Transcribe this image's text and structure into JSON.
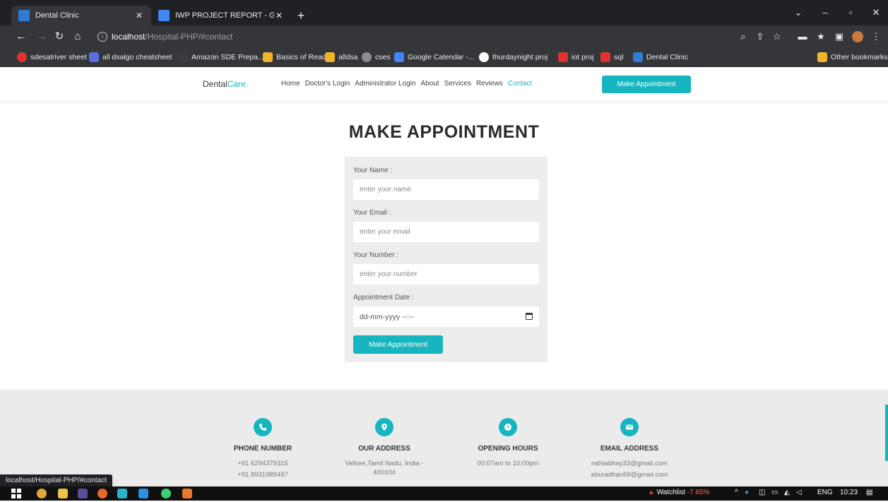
{
  "browser": {
    "tabs": [
      {
        "label": "Dental Clinic",
        "active": true
      },
      {
        "label": "IWP PROJECT REPORT - Google D",
        "active": false
      }
    ],
    "address": {
      "host": "localhost",
      "path": "/Hospital-PHP/#contact"
    },
    "bookmarks": [
      "sdesatriver sheet",
      "all dsalgo cheatsheet",
      "Amazon SDE Prepa...",
      "Basics of React",
      "alldsa",
      "cses",
      "Google Calendar -...",
      "thurdaynight proj",
      "iot proj",
      "sql",
      "Dental Clinic"
    ],
    "other_bookmarks": "Other bookmarks",
    "status_url": "localhost/Hospital-PHP/#contact"
  },
  "site": {
    "logo": {
      "prefix": "Dental",
      "accent": "Care."
    },
    "nav": [
      "Home",
      "Doctor's Login",
      "Administrator Login",
      "About",
      "Services",
      "Reviews",
      "Contact"
    ],
    "nav_active": "Contact",
    "nav_cta": "Make Appointment",
    "accent_color": "#16b5bf"
  },
  "form": {
    "heading": "MAKE APPOINTMENT",
    "name_label": "Your Name :",
    "name_placeholder": "enter your name",
    "email_label": "Your Email :",
    "email_placeholder": "enter your email",
    "number_label": "Your Number :",
    "number_placeholder": "enter your number",
    "date_label": "Appointment Date :",
    "date_value": "dd-mm-yyyy --:--",
    "submit": "Make Appointment"
  },
  "footer": {
    "phone": {
      "title": "PHONE NUMBER",
      "line1": "+91 6294379315",
      "line2": "+91 8931989497"
    },
    "address": {
      "title": "OUR ADDRESS",
      "line1": "Vellore,Tamil Nadu, India -",
      "line2": "400104"
    },
    "hours": {
      "title": "OPENING HOURS",
      "line1": "00:07am to 10:00pm"
    },
    "email": {
      "title": "EMAIL ADDRESS",
      "line1": "rathiabhay33@gmail.com",
      "line2": "aburadhan69@gmail.com"
    }
  },
  "taskbar": {
    "watchlist": "Watchlist",
    "change": "-7.65%",
    "lang": "ENG",
    "time": "10:23"
  }
}
